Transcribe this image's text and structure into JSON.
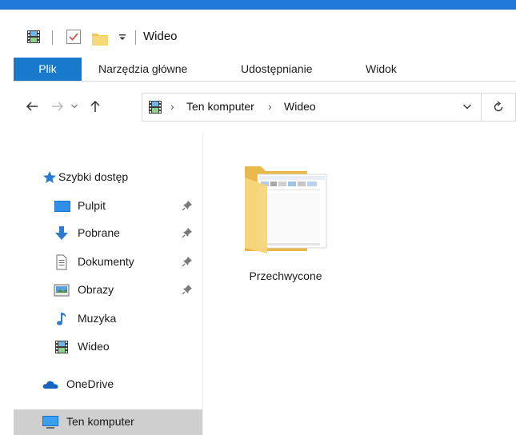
{
  "window": {
    "title": "Wideo"
  },
  "ribbon": {
    "tabs": [
      {
        "label": "Plik",
        "active": true
      },
      {
        "label": "Narzędzia główne",
        "active": false
      },
      {
        "label": "Udostępnianie",
        "active": false
      },
      {
        "label": "Widok",
        "active": false
      }
    ]
  },
  "address": {
    "crumbs": [
      "Ten komputer",
      "Wideo"
    ]
  },
  "navpane": {
    "items": [
      {
        "label": "Szybki dostęp",
        "icon": "star-icon",
        "pinned": false
      },
      {
        "label": "Pulpit",
        "icon": "desktop-icon",
        "pinned": true
      },
      {
        "label": "Pobrane",
        "icon": "download-arrow-icon",
        "pinned": true
      },
      {
        "label": "Dokumenty",
        "icon": "document-icon",
        "pinned": true
      },
      {
        "label": "Obrazy",
        "icon": "pictures-icon",
        "pinned": true
      },
      {
        "label": "Muzyka",
        "icon": "music-note-icon",
        "pinned": false
      },
      {
        "label": "Wideo",
        "icon": "film-icon",
        "pinned": false
      },
      {
        "label": "OneDrive",
        "icon": "cloud-icon",
        "pinned": false
      },
      {
        "label": "Ten komputer",
        "icon": "computer-icon",
        "pinned": false,
        "selected": true
      }
    ]
  },
  "content": {
    "items": [
      {
        "label": "Przechwycone",
        "icon": "folder-icon"
      }
    ]
  },
  "colors": {
    "accent": "#1979ca",
    "selection": "#cfcfcf",
    "folder": "#f3d37a"
  }
}
